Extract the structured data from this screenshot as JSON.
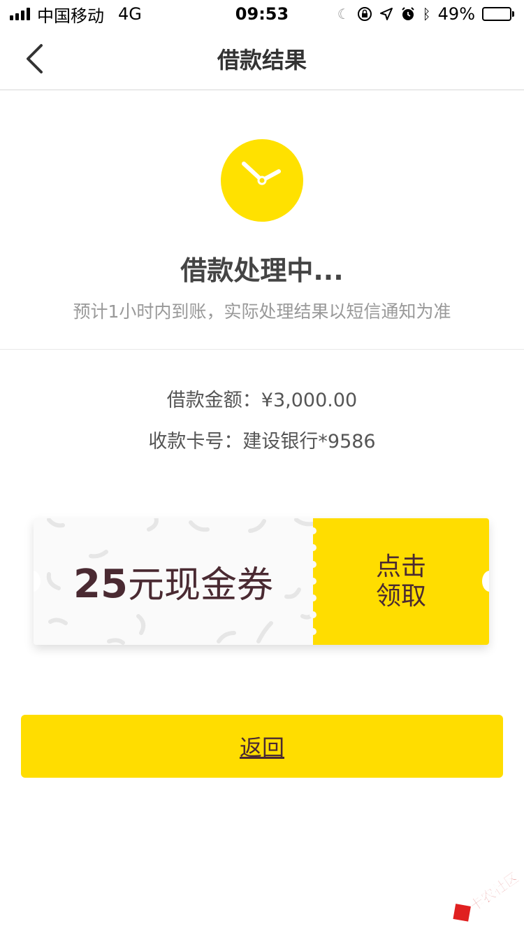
{
  "status_bar": {
    "carrier": "中国移动",
    "network": "4G",
    "time": "09:53",
    "battery": "49%",
    "battery_level": 0.49
  },
  "nav": {
    "title": "借款结果",
    "back_icon": "chevron-left-icon"
  },
  "status": {
    "icon": "clock-icon",
    "icon_color": "#ffe100",
    "title": "借款处理中...",
    "subtitle": "预计1小时内到账，实际处理结果以短信通知为准"
  },
  "info": {
    "amount_line": "借款金额：¥3,000.00",
    "card_line": "收款卡号：建设银行*9586"
  },
  "coupon": {
    "amount": "25",
    "label": "元现金券",
    "claim_label": "点击领取",
    "accent_color": "#ffdd00"
  },
  "return_button": {
    "label": "返回",
    "color": "#ffdd00"
  },
  "watermark": {
    "text": "卡农社区"
  }
}
